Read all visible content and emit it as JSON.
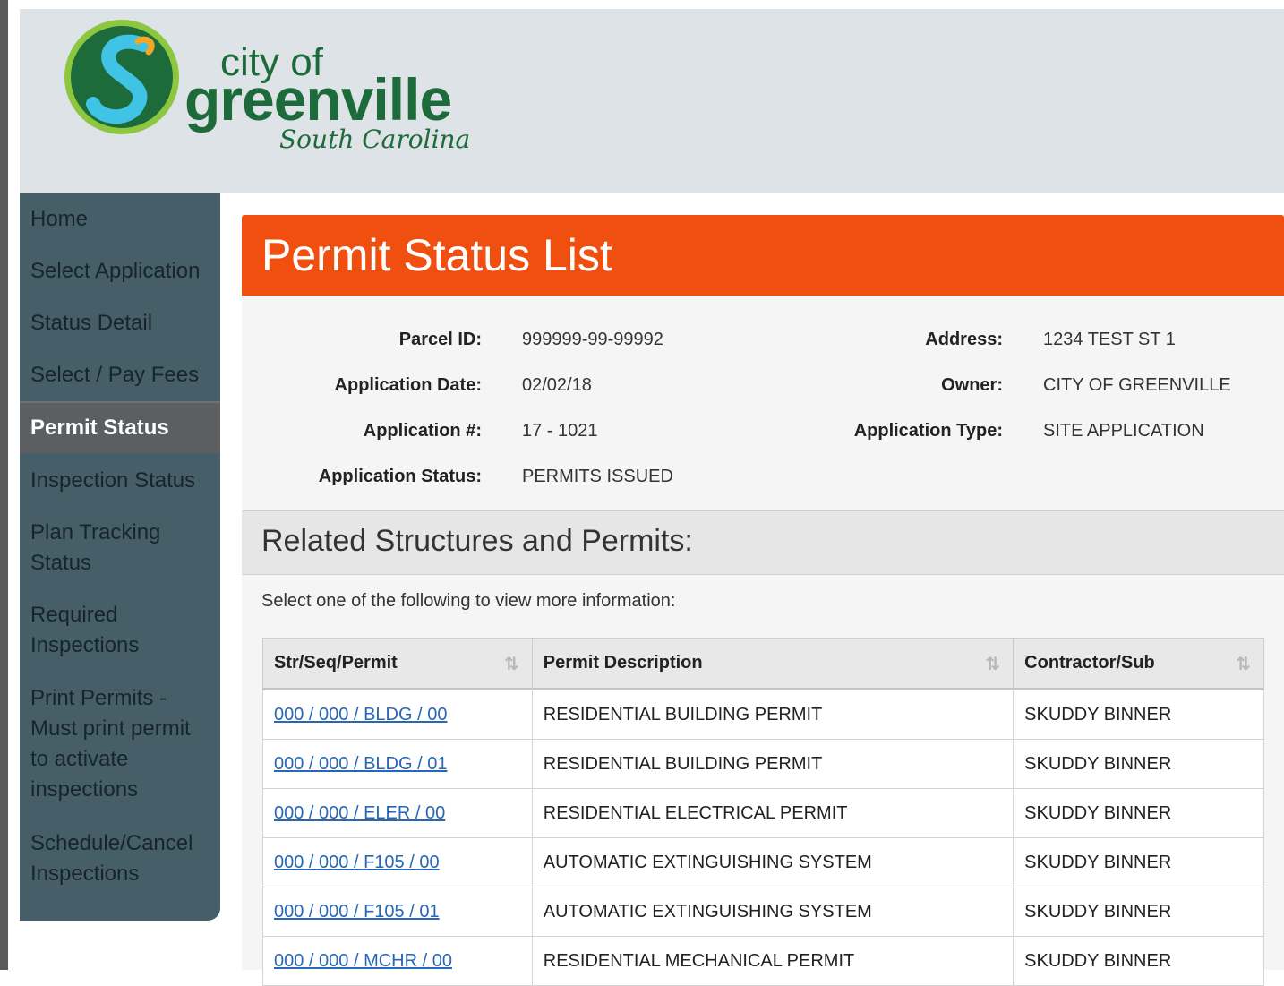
{
  "header": {
    "logo": {
      "line1": "city of",
      "line2": "greenville",
      "line3": "South Carolina"
    }
  },
  "sidebar": {
    "items": [
      {
        "label": "Home"
      },
      {
        "label": "Select Application"
      },
      {
        "label": "Status Detail"
      },
      {
        "label": "Select / Pay Fees"
      },
      {
        "label": "Permit Status",
        "active": true
      },
      {
        "label": "Inspection Status"
      },
      {
        "label": "Plan Tracking Status"
      },
      {
        "label": "Required Inspections"
      },
      {
        "label": "Print Permits - Must print permit to activate inspections"
      },
      {
        "label": "Schedule/Cancel Inspections"
      }
    ]
  },
  "page": {
    "title": "Permit Status List",
    "info": {
      "parcel_id_label": "Parcel ID:",
      "parcel_id": "999999-99-99992",
      "application_date_label": "Application Date:",
      "application_date": "02/02/18",
      "application_num_label": "Application #:",
      "application_num": "17 - 1021",
      "application_status_label": "Application Status:",
      "application_status": "PERMITS ISSUED",
      "address_label": "Address:",
      "address": "1234 TEST ST 1",
      "owner_label": "Owner:",
      "owner": "CITY OF GREENVILLE",
      "application_type_label": "Application Type:",
      "application_type": "SITE APPLICATION"
    },
    "section_title": "Related Structures and Permits:",
    "hint": "Select one of the following to view more information:"
  },
  "table": {
    "headers": [
      "Str/Seq/Permit",
      "Permit Description",
      "Contractor/Sub"
    ],
    "rows": [
      [
        "000 / 000 / BLDG / 00",
        "RESIDENTIAL BUILDING PERMIT",
        "SKUDDY BINNER"
      ],
      [
        "000 / 000 / BLDG / 01",
        "RESIDENTIAL BUILDING PERMIT",
        "SKUDDY BINNER"
      ],
      [
        "000 / 000 / ELER / 00",
        "RESIDENTIAL ELECTRICAL PERMIT",
        "SKUDDY BINNER"
      ],
      [
        "000 / 000 / F105 / 00",
        "AUTOMATIC EXTINGUISHING SYSTEM",
        "SKUDDY BINNER"
      ],
      [
        "000 / 000 / F105 / 01",
        "AUTOMATIC EXTINGUISHING SYSTEM",
        "SKUDDY BINNER"
      ],
      [
        "000 / 000 / MCHR / 00",
        "RESIDENTIAL MECHANICAL PERMIT",
        "SKUDDY BINNER"
      ]
    ]
  },
  "colors": {
    "title_bar": "#f04f0f",
    "sidebar": "#455e68",
    "sidebar_active": "#5b5f62",
    "banner": "#dde3e6",
    "link": "#2767b5",
    "logo_green": "#1d6b3a"
  }
}
